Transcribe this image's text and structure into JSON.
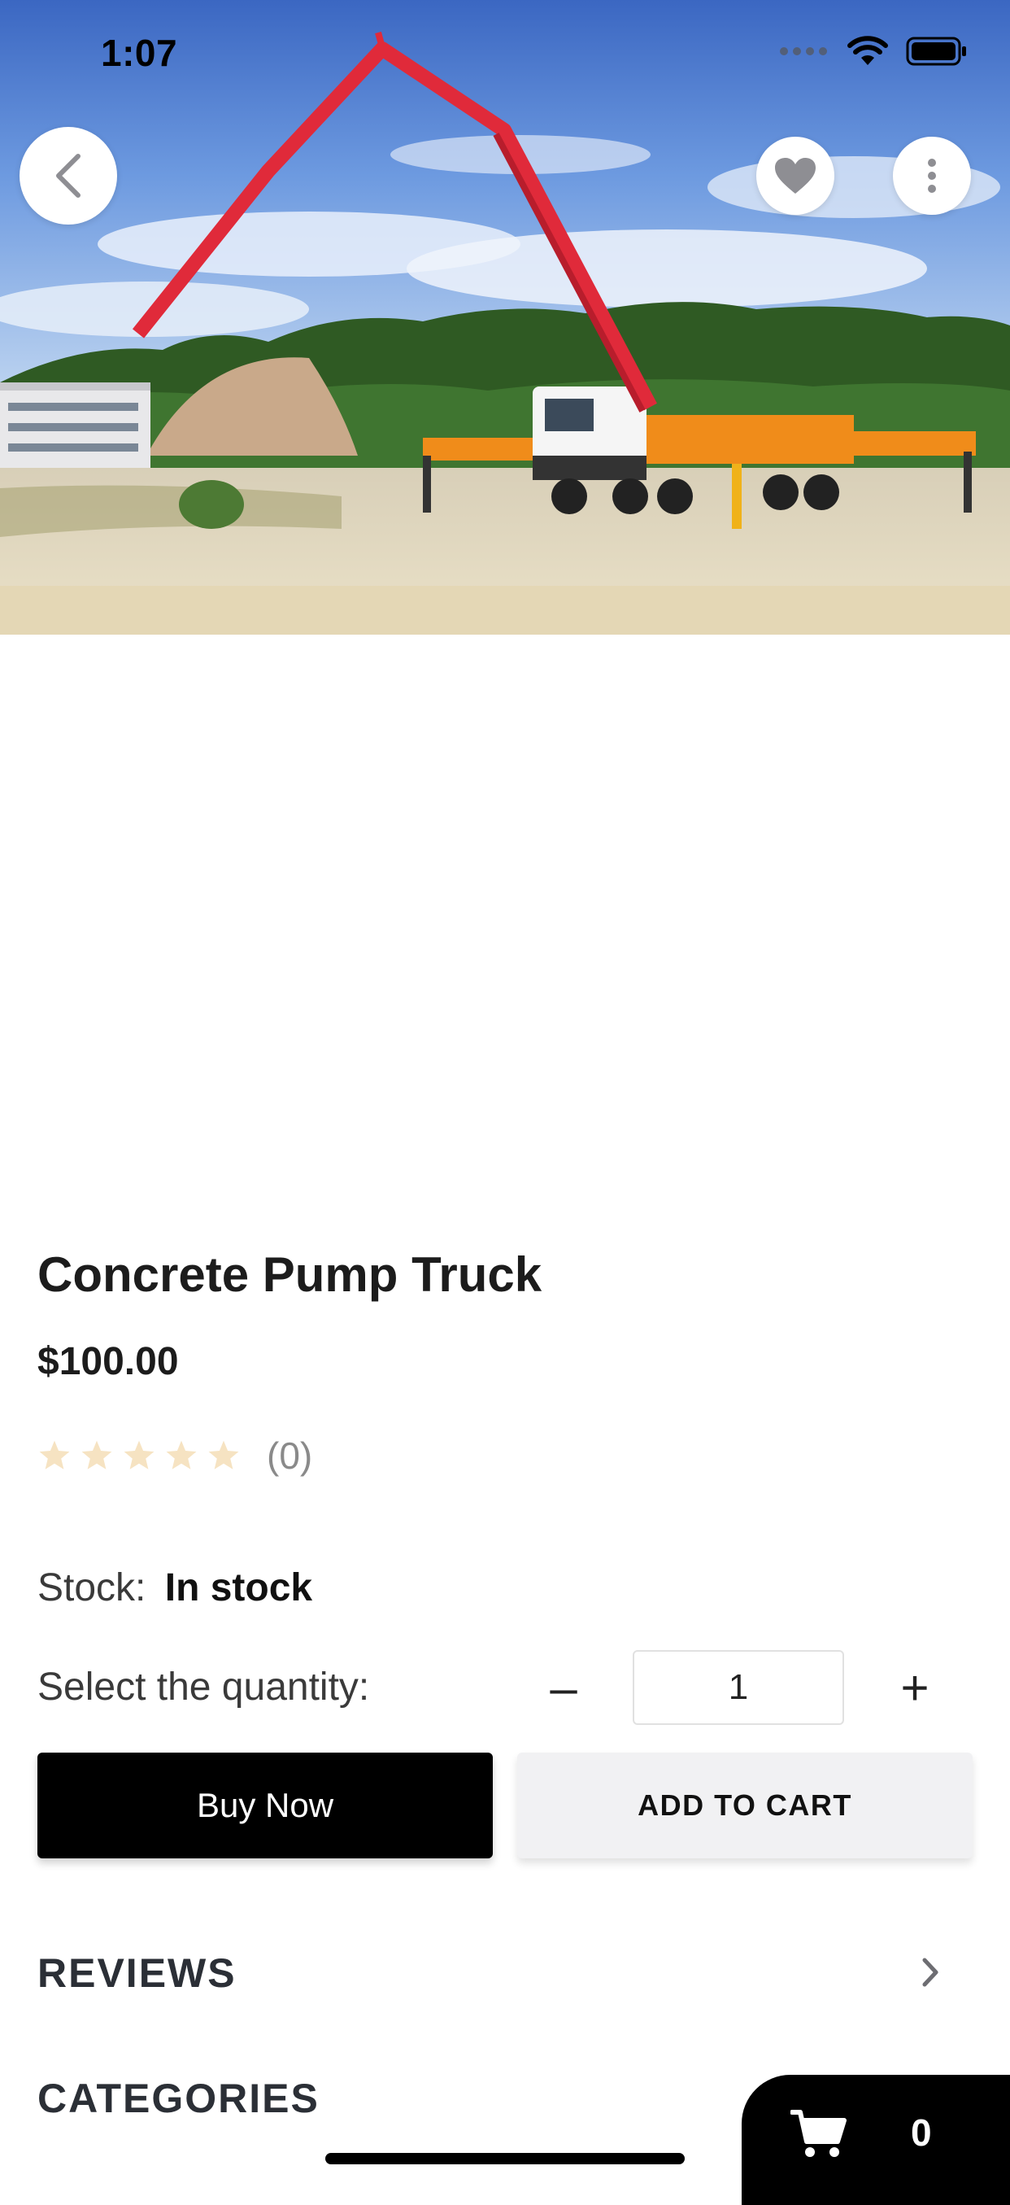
{
  "status_bar": {
    "time": "1:07"
  },
  "hero": {
    "image": "concrete pump truck photo"
  },
  "nav": {
    "back_icon": "chevron-left-icon",
    "favorite_icon": "heart-icon",
    "more_icon": "more-vertical-icon"
  },
  "product": {
    "title": "Concrete Pump Truck",
    "price": "$100.00",
    "rating_value": 0,
    "rating_max": 5,
    "rating_count": "(0)"
  },
  "stock": {
    "label": "Stock:",
    "value": "In stock"
  },
  "quantity": {
    "label": "Select the quantity:",
    "minus": "–",
    "plus": "+",
    "value": "1"
  },
  "actions": {
    "buy_now": "Buy Now",
    "add_to_cart": "ADD TO CART"
  },
  "sections": {
    "reviews": "REVIEWS",
    "categories": "CATEGORIES"
  },
  "cart": {
    "count": "0"
  },
  "colors": {
    "primary": "#000000",
    "secondary_button": "#f1f1f3",
    "star_empty": "#f6e3c2",
    "muted_text": "#8a8a8a"
  }
}
